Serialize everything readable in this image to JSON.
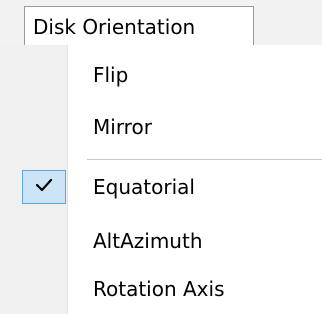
{
  "menu": {
    "title": "Disk Orientation"
  },
  "items": [
    {
      "label": "Flip",
      "checked": false
    },
    {
      "label": "Mirror",
      "checked": false
    },
    {
      "label": "Equatorial",
      "checked": true
    },
    {
      "label": "AltAzimuth",
      "checked": false
    },
    {
      "label": "Rotation Axis",
      "checked": false
    }
  ],
  "icons": {
    "checkmark": "checkmark-icon"
  },
  "colors": {
    "check_highlight_fill": "#cce4f7",
    "check_highlight_border": "#5fa7e0",
    "gutter": "#f0f0f0"
  }
}
